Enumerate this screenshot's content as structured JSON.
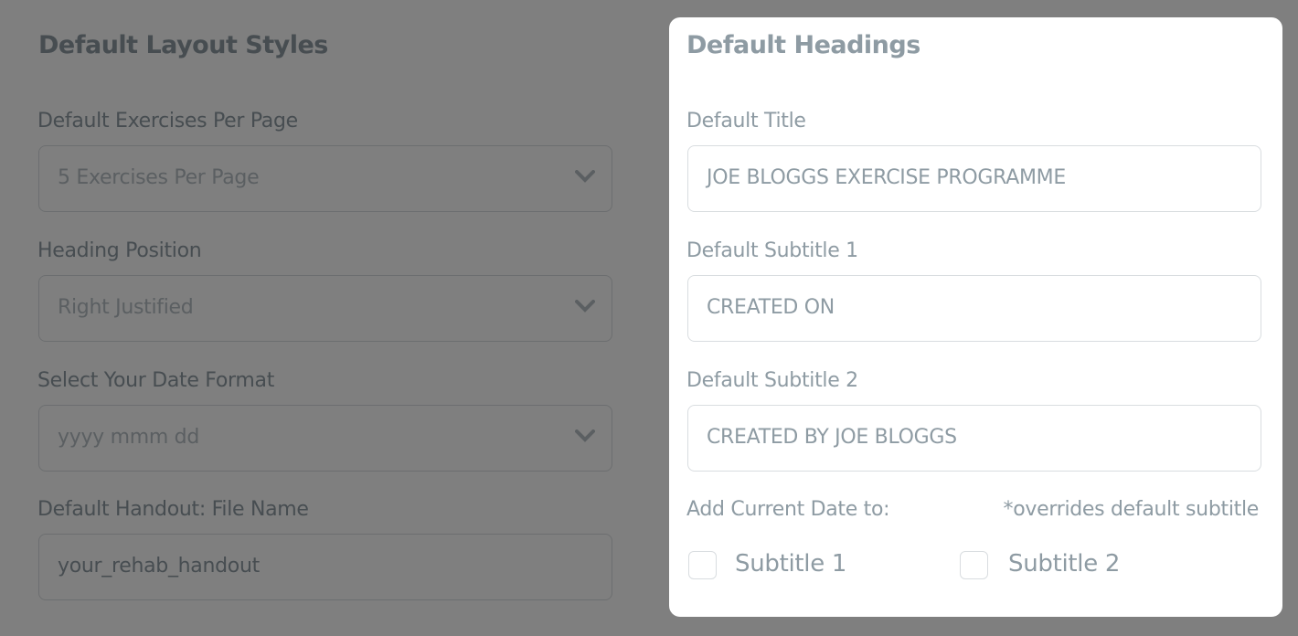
{
  "layout_styles": {
    "title": "Default Layout Styles",
    "exercises_per_page": {
      "label": "Default Exercises Per Page",
      "value": "5 Exercises Per Page"
    },
    "heading_position": {
      "label": "Heading Position",
      "value": "Right Justified"
    },
    "date_format": {
      "label": "Select Your Date Format",
      "value": "yyyy mmm dd"
    },
    "handout_file_name": {
      "label": "Default Handout: File Name",
      "value": "your_rehab_handout"
    }
  },
  "headings": {
    "title": "Default Headings",
    "default_title": {
      "label": "Default Title",
      "value": "JOE BLOGGS EXERCISE PROGRAMME"
    },
    "subtitle_1": {
      "label": "Default Subtitle 1",
      "value": "CREATED ON"
    },
    "subtitle_2": {
      "label": "Default Subtitle 2",
      "value": "CREATED BY JOE BLOGGS"
    },
    "add_date_label": "Add Current Date to:",
    "overrides_note": "*overrides default subtitle",
    "checkboxes": [
      {
        "label": "Subtitle 1",
        "checked": false
      },
      {
        "label": "Subtitle 2",
        "checked": false
      }
    ]
  }
}
